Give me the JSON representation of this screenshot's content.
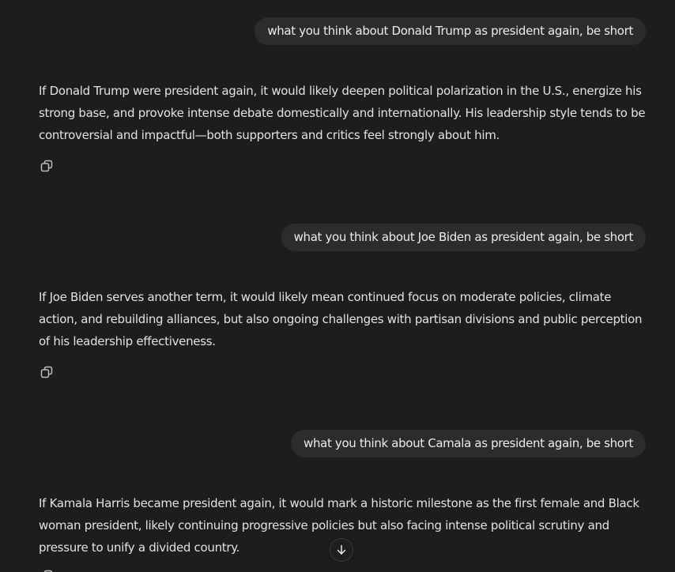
{
  "conversation": {
    "messages": [
      {
        "user": "what you think about Donald Trump as president again, be short",
        "assistant": "If Donald Trump were president again, it would likely deepen political polarization in the U.S., energize his strong base, and provoke intense debate domestically and internationally. His leadership style tends to be controversial and impactful—both supporters and critics feel strongly about him."
      },
      {
        "user": "what you think about Joe Biden as president again, be short",
        "assistant": "If Joe Biden serves another term, it would likely mean continued focus on moderate policies, climate action, and rebuilding alliances, but also ongoing challenges with partisan divisions and public perception of his leadership effectiveness."
      },
      {
        "user": "what you think about Camala as president again, be short",
        "assistant": "If Kamala Harris became president again, it would mark a historic milestone as the first female and Black woman president, likely continuing progressive policies but also facing intense political scrutiny and pressure to unify a divided country."
      }
    ]
  },
  "icons": {
    "copy": "copy-icon",
    "scroll_down": "arrow-down-icon"
  },
  "colors": {
    "background": "#1d1d1f",
    "user_bubble": "#2c2c2e",
    "text": "#e2e2e2",
    "icon": "#bdbdbd"
  }
}
